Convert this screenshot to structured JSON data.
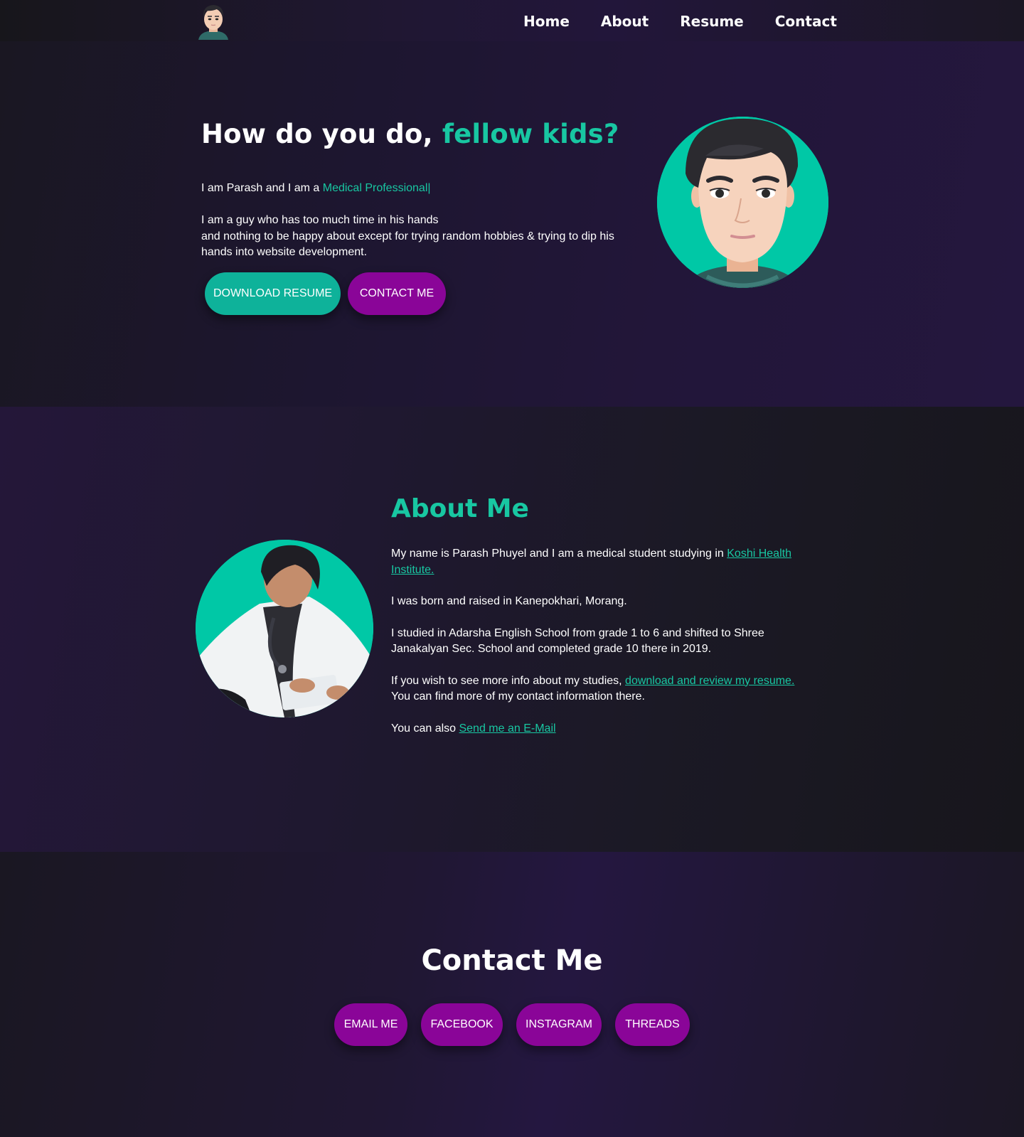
{
  "nav": {
    "logo_alt": "avatar logo",
    "links": [
      "Home",
      "About",
      "Resume",
      "Contact"
    ]
  },
  "hero": {
    "title_plain": "How do you do, ",
    "title_accent": "fellow kids?",
    "intro_prefix": "I am Parash and I am a ",
    "intro_role": "Medical Professional",
    "intro_cursor": "|",
    "bio_line1": "I am a guy who has too much time in his hands",
    "bio_line2": "and nothing to be happy about except for trying random hobbies & trying to dip his hands into website development.",
    "download_button": "DOWNLOAD RESUME",
    "contact_button": "CONTACT ME"
  },
  "about": {
    "title": "About Me",
    "p1_text": "My name is Parash Phuyel and I am a medical student studying in ",
    "p1_link": "Koshi Health Institute.",
    "p2_text": "I was born and raised in Kanepokhari, Morang.",
    "p3_text": "I studied in Adarsha English School from grade 1 to 6 and shifted to Shree Janakalyan Sec. School and completed grade 10 there in 2019.",
    "p4_text": "If you wish to see more info about my studies, ",
    "p4_link": "download and review my resume.",
    "p4_after": "You can find more of my contact information there.",
    "p5_text": "You can also ",
    "p5_link": "Send me an E-Mail"
  },
  "contact": {
    "title": "Contact Me",
    "buttons": [
      "EMAIL ME",
      "FACEBOOK",
      "INSTAGRAM",
      "THREADS"
    ]
  },
  "colors": {
    "accent": "#18c7a2",
    "teal_button": "#0eb29a",
    "purple_button": "#8a0598"
  }
}
